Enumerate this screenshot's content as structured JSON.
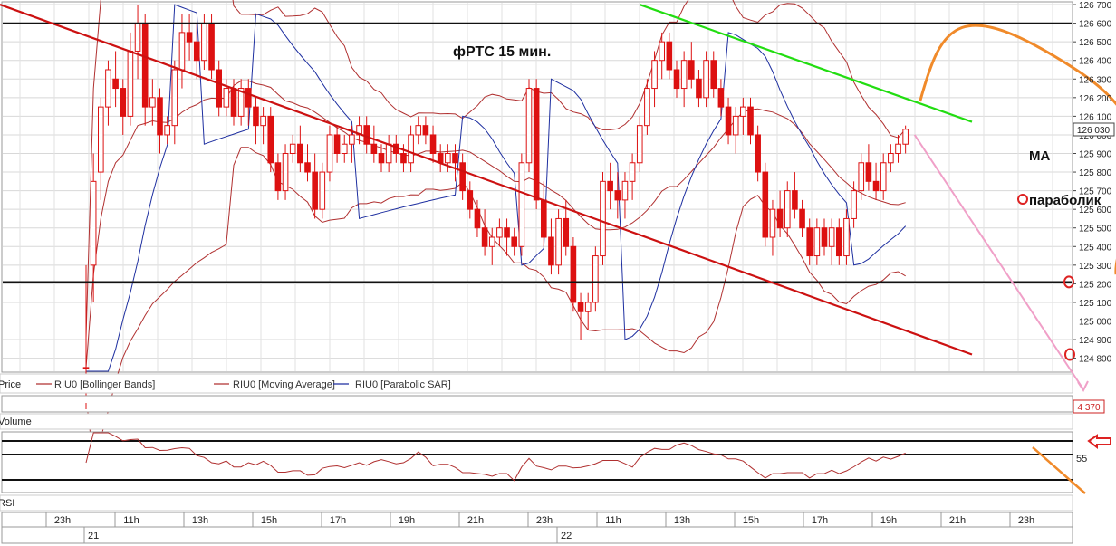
{
  "chart_data": [
    {
      "type": "candlestick",
      "title": "фРТС   15 мин.",
      "panel_label": "Price",
      "legend": [
        {
          "name": "RIU0 [Bollinger Bands]",
          "color": "#b03030"
        },
        {
          "name": "RIU0 [Moving Average]",
          "color": "#b03030"
        },
        {
          "name": "RIU0 [Parabolic SAR]",
          "color": "#1e2fa0"
        }
      ],
      "yticks": [
        "126 700",
        "126 600",
        "126 500",
        "126 400",
        "126 300",
        "126 200",
        "126 100",
        "126 000",
        "125 900",
        "125 800",
        "125 700",
        "125 600",
        "125 500",
        "125 400",
        "125 300",
        "125 200",
        "125 100",
        "125 000",
        "124 900",
        "124 800"
      ],
      "ylim": [
        124730,
        126710
      ],
      "price_marker": "126 030",
      "candle_color": "#dd1111",
      "candles": [
        [
          124750,
          125300,
          124550,
          124750
        ],
        [
          125300,
          125900,
          125100,
          125750
        ],
        [
          125800,
          126200,
          125650,
          126150
        ],
        [
          126150,
          126400,
          126050,
          126350
        ],
        [
          126300,
          126450,
          126150,
          126250
        ],
        [
          126250,
          126300,
          126000,
          126100
        ],
        [
          126100,
          126550,
          126050,
          126450
        ],
        [
          126450,
          126700,
          126300,
          126600
        ],
        [
          126600,
          126650,
          126050,
          126150
        ],
        [
          126150,
          126300,
          126050,
          126200
        ],
        [
          126200,
          126250,
          125900,
          126000
        ],
        [
          126000,
          126100,
          125950,
          126050
        ],
        [
          126050,
          126400,
          125950,
          126350
        ],
        [
          126350,
          126650,
          126250,
          126550
        ],
        [
          126550,
          126650,
          126400,
          126500
        ],
        [
          126500,
          126600,
          126300,
          126400
        ],
        [
          126400,
          126650,
          126350,
          126600
        ],
        [
          126600,
          126650,
          126300,
          126350
        ],
        [
          126350,
          126400,
          126100,
          126150
        ],
        [
          126150,
          126300,
          126100,
          126250
        ],
        [
          126250,
          126300,
          126050,
          126100
        ],
        [
          126100,
          126300,
          126050,
          126250
        ],
        [
          126250,
          126300,
          126050,
          126150
        ],
        [
          126150,
          126200,
          125950,
          126050
        ],
        [
          126050,
          126150,
          125950,
          126100
        ],
        [
          126100,
          126150,
          125800,
          125850
        ],
        [
          125850,
          125900,
          125650,
          125700
        ],
        [
          125700,
          125950,
          125650,
          125900
        ],
        [
          125900,
          126000,
          125850,
          125950
        ],
        [
          125950,
          126050,
          125800,
          125850
        ],
        [
          125850,
          125950,
          125750,
          125800
        ],
        [
          125800,
          125900,
          125550,
          125600
        ],
        [
          125600,
          125850,
          125550,
          125800
        ],
        [
          125800,
          126050,
          125750,
          126000
        ],
        [
          126000,
          126050,
          125850,
          125900
        ],
        [
          125900,
          126000,
          125850,
          125950
        ],
        [
          125950,
          126050,
          125850,
          126000
        ],
        [
          126000,
          126100,
          125950,
          126050
        ],
        [
          126050,
          126100,
          125900,
          125950
        ],
        [
          125950,
          126050,
          125850,
          125900
        ],
        [
          125900,
          125950,
          125800,
          125850
        ],
        [
          125850,
          126000,
          125800,
          125950
        ],
        [
          125950,
          126000,
          125850,
          125900
        ],
        [
          125900,
          125950,
          125800,
          125850
        ],
        [
          125850,
          126050,
          125800,
          126000
        ],
        [
          126000,
          126100,
          125950,
          126050
        ],
        [
          126050,
          126100,
          125950,
          126000
        ],
        [
          126000,
          126050,
          125850,
          125900
        ],
        [
          125900,
          125950,
          125800,
          125850
        ],
        [
          125850,
          125950,
          125800,
          125900
        ],
        [
          125900,
          125950,
          125750,
          125850
        ],
        [
          125850,
          125900,
          125650,
          125700
        ],
        [
          125700,
          125750,
          125550,
          125600
        ],
        [
          125600,
          125650,
          125450,
          125500
        ],
        [
          125500,
          125600,
          125350,
          125400
        ],
        [
          125400,
          125500,
          125300,
          125450
        ],
        [
          125450,
          125550,
          125400,
          125500
        ],
        [
          125500,
          125550,
          125350,
          125450
        ],
        [
          125450,
          125500,
          125350,
          125400
        ],
        [
          125400,
          125900,
          125350,
          125850
        ],
        [
          125850,
          126300,
          125800,
          126250
        ],
        [
          126250,
          126300,
          125600,
          125650
        ],
        [
          125650,
          125750,
          125400,
          125450
        ],
        [
          125450,
          125550,
          125250,
          125300
        ],
        [
          125300,
          125600,
          125250,
          125550
        ],
        [
          125550,
          125650,
          125350,
          125400
        ],
        [
          125400,
          125450,
          125050,
          125100
        ],
        [
          125100,
          125150,
          124900,
          125050
        ],
        [
          125050,
          125150,
          124950,
          125100
        ],
        [
          125100,
          125400,
          125050,
          125350
        ],
        [
          125350,
          125800,
          125300,
          125750
        ],
        [
          125750,
          125850,
          125600,
          125700
        ],
        [
          125700,
          125800,
          125550,
          125650
        ],
        [
          125650,
          125800,
          125550,
          125750
        ],
        [
          125750,
          125900,
          125650,
          125850
        ],
        [
          125850,
          126100,
          125800,
          126050
        ],
        [
          126050,
          126300,
          126000,
          126250
        ],
        [
          126250,
          126450,
          126150,
          126400
        ],
        [
          126400,
          126550,
          126300,
          126500
        ],
        [
          126500,
          126550,
          126300,
          126350
        ],
        [
          126350,
          126400,
          126200,
          126250
        ],
        [
          126250,
          126450,
          126150,
          126400
        ],
        [
          126400,
          126500,
          126250,
          126300
        ],
        [
          126300,
          126350,
          126150,
          126200
        ],
        [
          126200,
          126450,
          126150,
          126400
        ],
        [
          126400,
          126450,
          126200,
          126250
        ],
        [
          126250,
          126300,
          126100,
          126150
        ],
        [
          126150,
          126200,
          125950,
          126000
        ],
        [
          126000,
          126150,
          125900,
          126100
        ],
        [
          126100,
          126200,
          126000,
          126150
        ],
        [
          126150,
          126200,
          125950,
          126000
        ],
        [
          126000,
          126050,
          125750,
          125800
        ],
        [
          125800,
          125850,
          125400,
          125450
        ],
        [
          125450,
          125650,
          125350,
          125600
        ],
        [
          125600,
          125700,
          125450,
          125500
        ],
        [
          125500,
          125750,
          125450,
          125700
        ],
        [
          125700,
          125800,
          125550,
          125600
        ],
        [
          125600,
          125650,
          125450,
          125500
        ],
        [
          125500,
          125550,
          125300,
          125350
        ],
        [
          125350,
          125550,
          125300,
          125500
        ],
        [
          125500,
          125550,
          125350,
          125400
        ],
        [
          125400,
          125550,
          125300,
          125500
        ],
        [
          125500,
          125550,
          125300,
          125350
        ],
        [
          125350,
          125600,
          125300,
          125550
        ],
        [
          125550,
          125750,
          125500,
          125700
        ],
        [
          125700,
          125900,
          125650,
          125850
        ],
        [
          125850,
          125950,
          125700,
          125750
        ],
        [
          125750,
          125850,
          125650,
          125700
        ],
        [
          125700,
          125900,
          125650,
          125850
        ],
        [
          125850,
          125950,
          125800,
          125900
        ],
        [
          125900,
          126000,
          125850,
          125950
        ],
        [
          125950,
          126050,
          125900,
          126030
        ]
      ],
      "overlays": {
        "parabolic_sar": {
          "name": "RIU0 [Parabolic SAR]",
          "color": "#1e2fa0"
        },
        "bollinger_bands": {
          "name": "RIU0 [Bollinger Bands]",
          "color": "#b03030"
        },
        "moving_average": {
          "name": "RIU0 [Moving Average]",
          "color": "#b03030"
        }
      },
      "trendlines": [
        {
          "color": "#cc1111",
          "from": [
            0,
            126700
          ],
          "to": [
            120,
            124820
          ]
        },
        {
          "color": "#22dd11",
          "from": [
            75,
            126700
          ],
          "to": [
            120,
            126070
          ]
        }
      ],
      "horizontal_lines": [
        126600,
        125210
      ],
      "annotations": [
        {
          "text": "МА",
          "color": "#111111"
        },
        {
          "text": "параболик",
          "color": "#111111"
        }
      ]
    },
    {
      "type": "bar",
      "panel_label": "Volume",
      "value_marker": "4 370"
    },
    {
      "type": "line",
      "panel_label": "RSI",
      "ytick": "55",
      "color": "#b03030"
    }
  ],
  "time_axis": {
    "hour_labels": [
      "23h",
      "11h",
      "13h",
      "15h",
      "17h",
      "19h",
      "21h",
      "23h",
      "11h",
      "13h",
      "15h",
      "17h",
      "19h",
      "21h",
      "23h"
    ],
    "day_labels": [
      "21",
      "22"
    ]
  }
}
